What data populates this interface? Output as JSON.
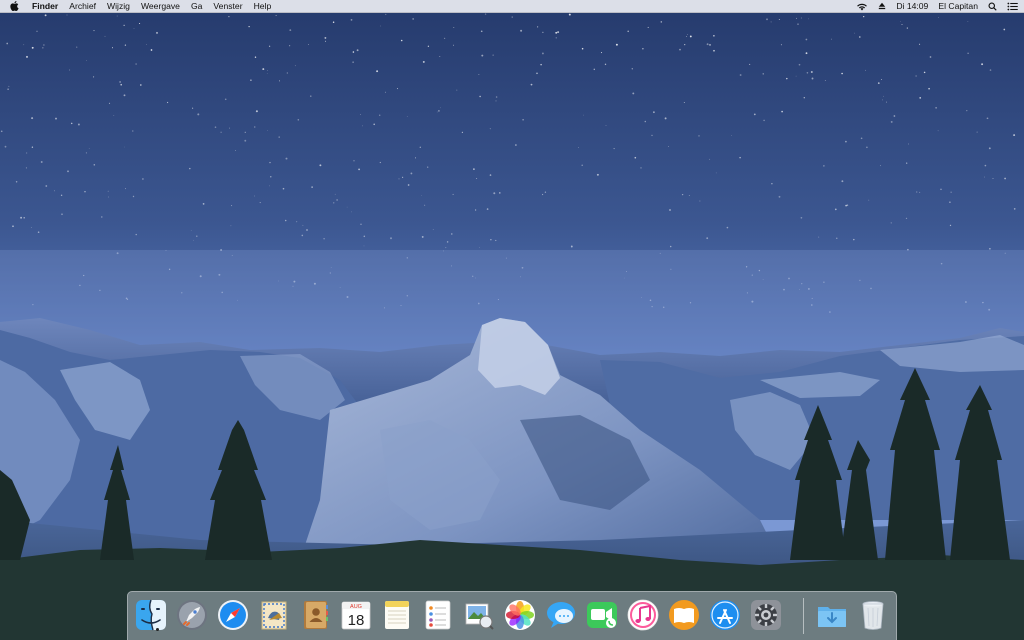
{
  "menubar": {
    "app_name": "Finder",
    "items": [
      "Archief",
      "Wijzig",
      "Weergave",
      "Ga",
      "Venster",
      "Help"
    ],
    "clock": "Di 14:09",
    "user": "El Capitan"
  },
  "dock": {
    "apps": [
      {
        "id": "finder",
        "icon": "finder-icon",
        "running": true
      },
      {
        "id": "launchpad",
        "icon": "launchpad-icon"
      },
      {
        "id": "safari",
        "icon": "safari-icon"
      },
      {
        "id": "mail",
        "icon": "mail-icon"
      },
      {
        "id": "contacts",
        "icon": "contacts-icon"
      },
      {
        "id": "calendar",
        "icon": "calendar-icon",
        "month": "AUG",
        "day": "18"
      },
      {
        "id": "notes",
        "icon": "notes-icon"
      },
      {
        "id": "reminders",
        "icon": "reminders-icon"
      },
      {
        "id": "preview",
        "icon": "preview-icon"
      },
      {
        "id": "photos",
        "icon": "photos-icon"
      },
      {
        "id": "messages",
        "icon": "messages-icon"
      },
      {
        "id": "facetime",
        "icon": "facetime-icon"
      },
      {
        "id": "itunes",
        "icon": "itunes-icon"
      },
      {
        "id": "ibooks",
        "icon": "ibooks-icon"
      },
      {
        "id": "appstore",
        "icon": "app-store-icon"
      },
      {
        "id": "systemprefs",
        "icon": "system-preferences-icon"
      },
      {
        "id": "downloads",
        "icon": "downloads-folder-icon"
      },
      {
        "id": "trash",
        "icon": "trash-icon"
      }
    ]
  },
  "colors": {
    "sky_top": "#2b3f73",
    "sky_bottom": "#6f8fd0",
    "mountain": "#5a74a8",
    "trees": "#1d2e2c"
  }
}
